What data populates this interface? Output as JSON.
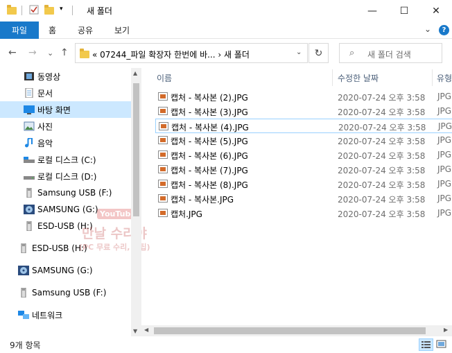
{
  "window": {
    "title": "새 폴더",
    "controls": {
      "minimize": "—",
      "maximize": "☐",
      "close": "✕"
    }
  },
  "ribbon": {
    "tabs": [
      "파일",
      "홈",
      "공유",
      "보기"
    ],
    "expand_icon": "⌄",
    "help_icon": "?"
  },
  "nav": {
    "back": "←",
    "forward": "→",
    "history": "⌄",
    "up": "↑",
    "address": "« 07244_파일 확장자 한번에 바...  ›  새 폴더",
    "address_dropdown": "⌄",
    "refresh": "↻",
    "search_placeholder": "새 폴더 검색",
    "search_icon": "⌕"
  },
  "sidebar": {
    "items": [
      {
        "label": "동영상",
        "icon": "video-icon"
      },
      {
        "label": "문서",
        "icon": "document-icon"
      },
      {
        "label": "바탕 화면",
        "icon": "desktop-icon",
        "selected": true
      },
      {
        "label": "사진",
        "icon": "picture-icon"
      },
      {
        "label": "음악",
        "icon": "music-icon"
      },
      {
        "label": "로컬 디스크 (C:)",
        "icon": "drive-icon"
      },
      {
        "label": "로컬 디스크 (D:)",
        "icon": "drive-icon"
      },
      {
        "label": "Samsung USB (F:)",
        "icon": "usb-icon"
      },
      {
        "label": "SAMSUNG (G:)",
        "icon": "cd-drive-icon"
      },
      {
        "label": "ESD-USB (H:)",
        "icon": "usb-icon"
      },
      {
        "label": "ESD-USB (H:)",
        "icon": "usb-icon"
      },
      {
        "label": "SAMSUNG (G:)",
        "icon": "cd-drive-icon"
      },
      {
        "label": "Samsung USB (F:)",
        "icon": "usb-icon"
      },
      {
        "label": "네트워크",
        "icon": "network-icon"
      }
    ]
  },
  "watermark": {
    "badge": "YouTube",
    "line1": "만날 수리야",
    "line2": "(PC 무료 수리, 꿀팁)"
  },
  "filelist": {
    "columns": {
      "name": "이름",
      "date": "수정한 날짜",
      "type": "유형"
    },
    "sort_indicator": "^",
    "files": [
      {
        "name": "캡처 - 복사본 (2).JPG",
        "date": "2020-07-24 오후 3:58",
        "type": "JPG"
      },
      {
        "name": "캡처 - 복사본 (3).JPG",
        "date": "2020-07-24 오후 3:58",
        "type": "JPG"
      },
      {
        "name": "캡처 - 복사본 (4).JPG",
        "date": "2020-07-24 오후 3:58",
        "type": "JPG",
        "focused": true
      },
      {
        "name": "캡처 - 복사본 (5).JPG",
        "date": "2020-07-24 오후 3:58",
        "type": "JPG"
      },
      {
        "name": "캡처 - 복사본 (6).JPG",
        "date": "2020-07-24 오후 3:58",
        "type": "JPG"
      },
      {
        "name": "캡처 - 복사본 (7).JPG",
        "date": "2020-07-24 오후 3:58",
        "type": "JPG"
      },
      {
        "name": "캡처 - 복사본 (8).JPG",
        "date": "2020-07-24 오후 3:58",
        "type": "JPG"
      },
      {
        "name": "캡처 - 복사본.JPG",
        "date": "2020-07-24 오후 3:58",
        "type": "JPG"
      },
      {
        "name": "캡처.JPG",
        "date": "2020-07-24 오후 3:58",
        "type": "JPG"
      }
    ]
  },
  "statusbar": {
    "item_count": "9개 항목"
  },
  "colors": {
    "accent": "#1979ca",
    "selection": "#cce8ff",
    "focus_border": "#99d1ff",
    "folder": "#f2c94c"
  }
}
